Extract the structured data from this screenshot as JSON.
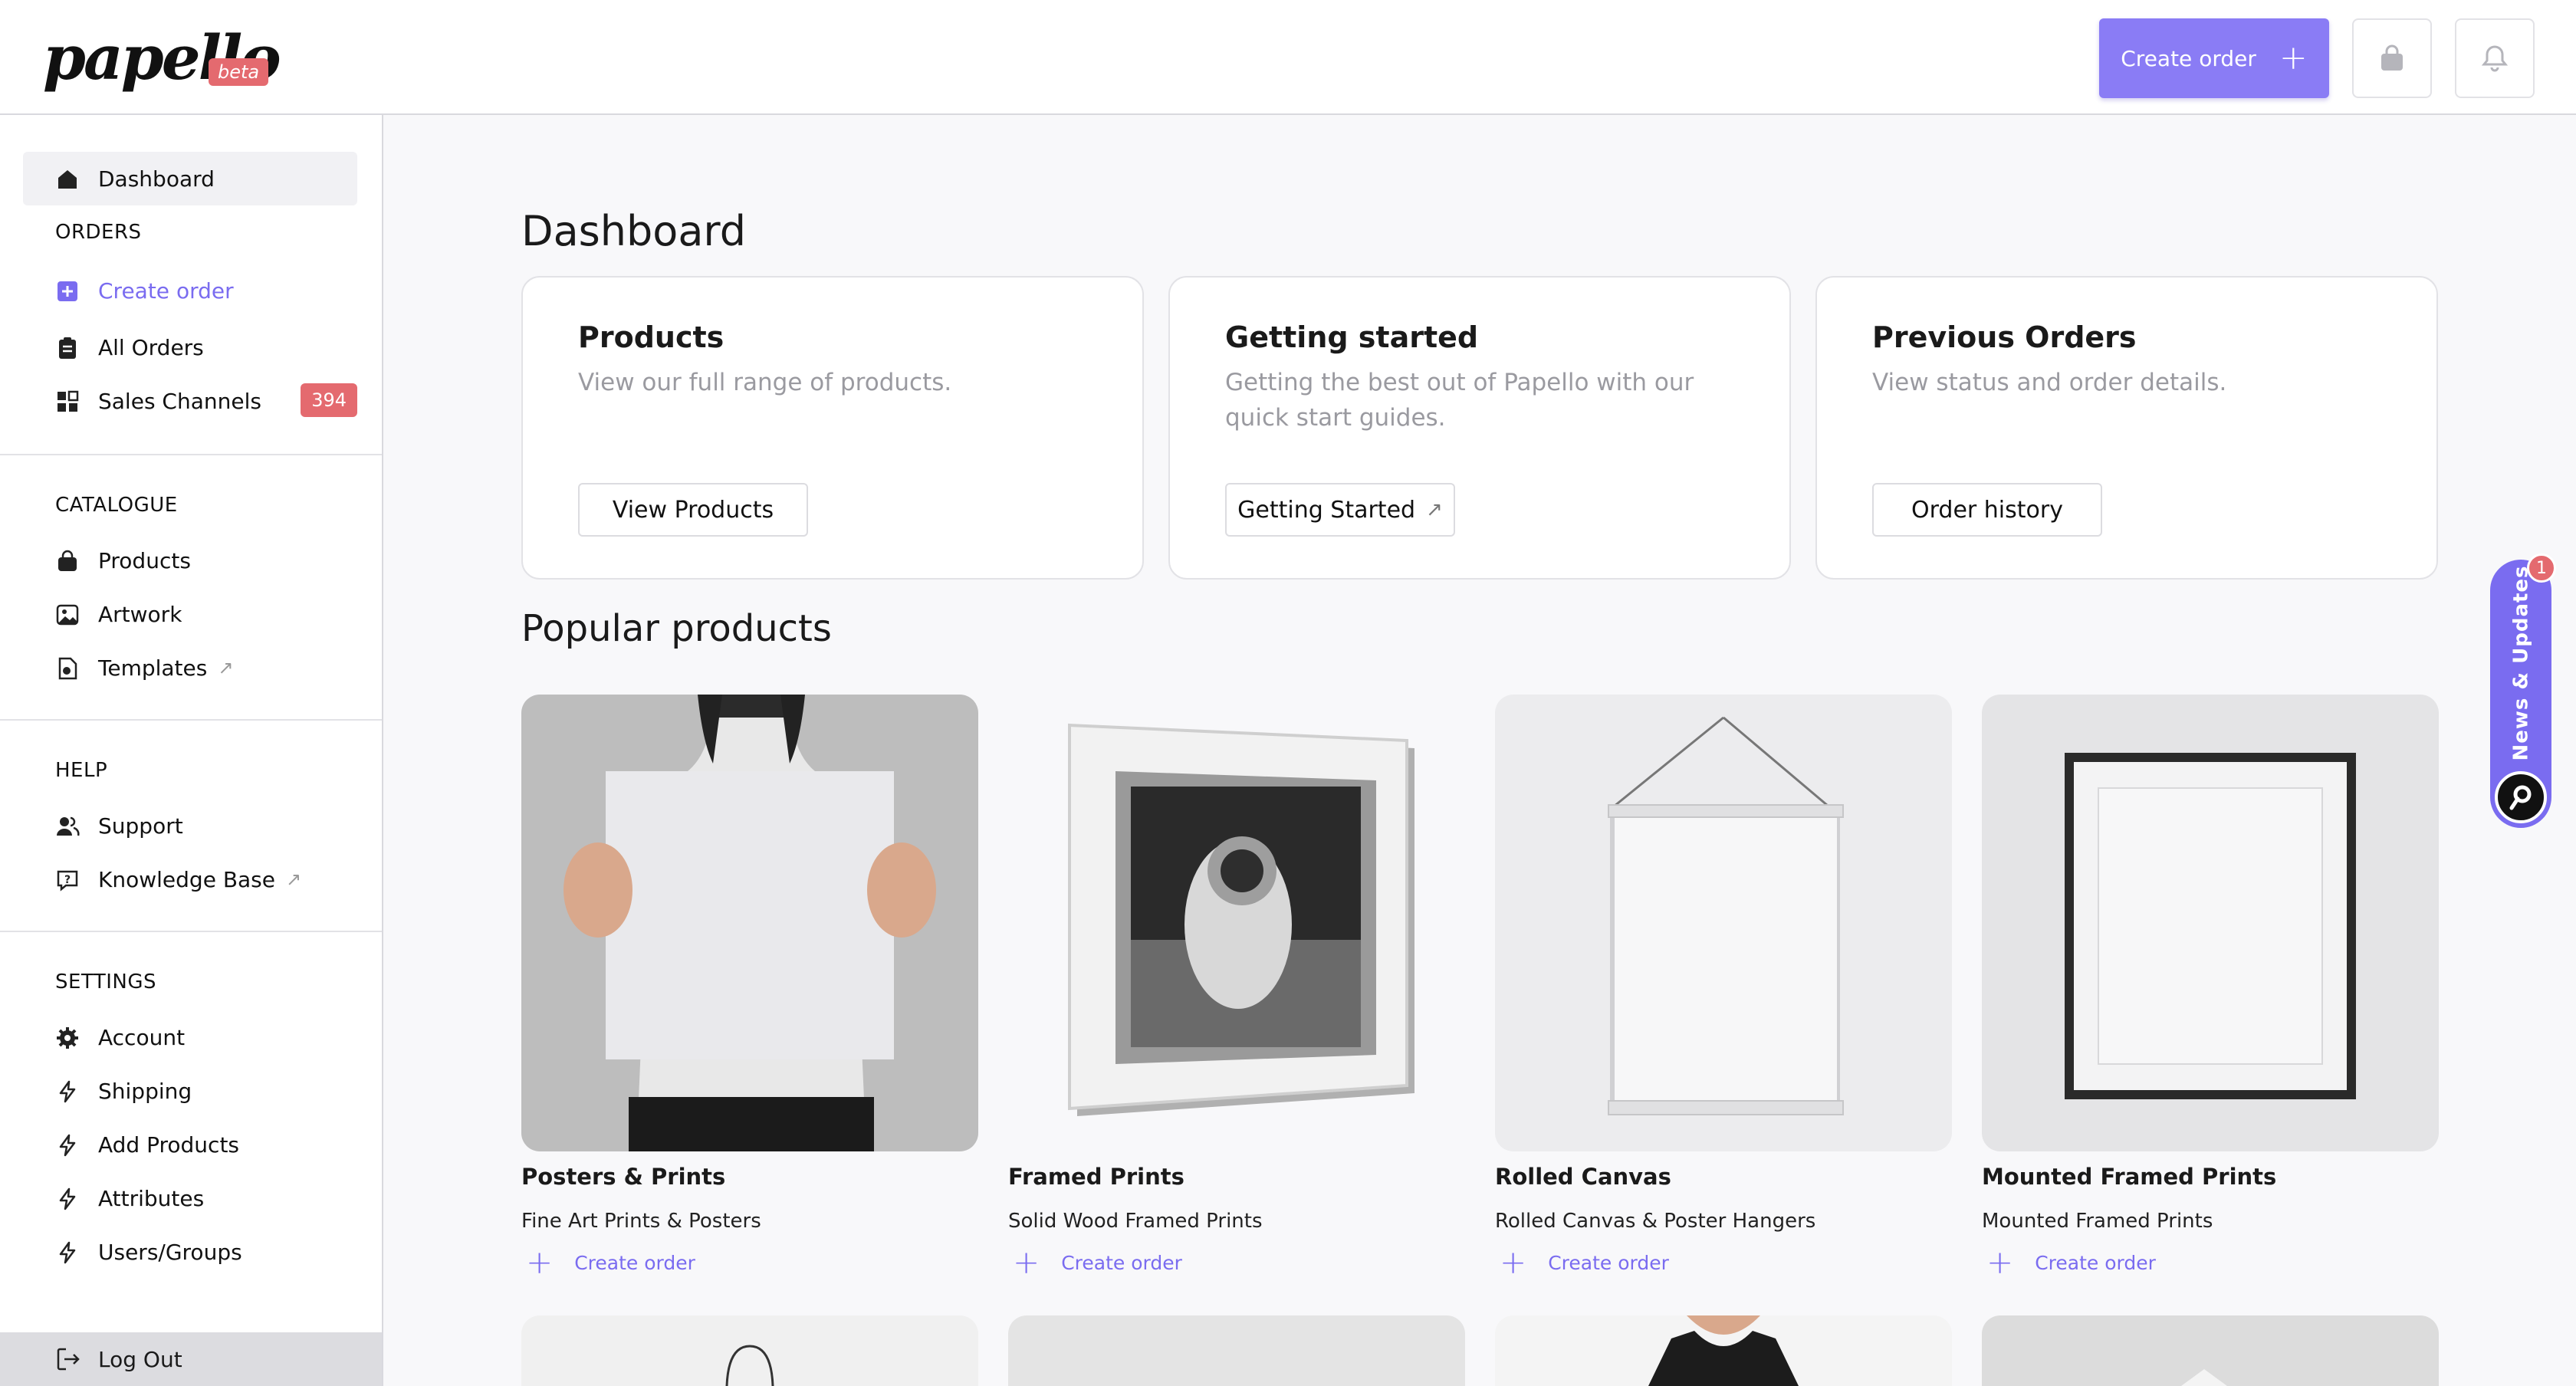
{
  "header": {
    "logo_text": "papello",
    "logo_badge": "beta",
    "create_order_label": "Create order",
    "bag_icon": "shopping-bag-icon",
    "bell_icon": "bell-icon"
  },
  "sidebar": {
    "dashboard": "Dashboard",
    "orders_heading": "ORDERS",
    "create_order": "Create order",
    "all_orders": "All Orders",
    "sales_channels": "Sales Channels",
    "sales_channels_count": "394",
    "catalogue_heading": "CATALOGUE",
    "products": "Products",
    "artwork": "Artwork",
    "templates": "Templates",
    "help_heading": "HELP",
    "support": "Support",
    "knowledge_base": "Knowledge Base",
    "settings_heading": "SETTINGS",
    "account": "Account",
    "shipping": "Shipping",
    "add_products": "Add Products",
    "attributes": "Attributes",
    "users_groups": "Users/Groups",
    "log_out": "Log Out"
  },
  "main": {
    "title": "Dashboard",
    "cards": [
      {
        "title": "Products",
        "desc": "View our full range of products.",
        "button": "View Products"
      },
      {
        "title": "Getting started",
        "desc": "Getting the best out of Papello with our quick start guides.",
        "button": "Getting Started"
      },
      {
        "title": "Previous Orders",
        "desc": "View status and order details.",
        "button": "Order history"
      }
    ],
    "popular_title": "Popular products",
    "products": [
      {
        "name": "Posters & Prints",
        "desc": "Fine Art Prints & Posters",
        "link": "Create order"
      },
      {
        "name": "Framed Prints",
        "desc": "Solid Wood Framed Prints",
        "link": "Create order"
      },
      {
        "name": "Rolled Canvas",
        "desc": "Rolled Canvas & Poster Hangers",
        "link": "Create order"
      },
      {
        "name": "Mounted Framed Prints",
        "desc": "Mounted Framed Prints",
        "link": "Create order"
      }
    ]
  },
  "news": {
    "label": "News & Updates",
    "badge": "1"
  },
  "colors": {
    "accent": "#8a7cf5",
    "badge": "#e46a6f"
  }
}
